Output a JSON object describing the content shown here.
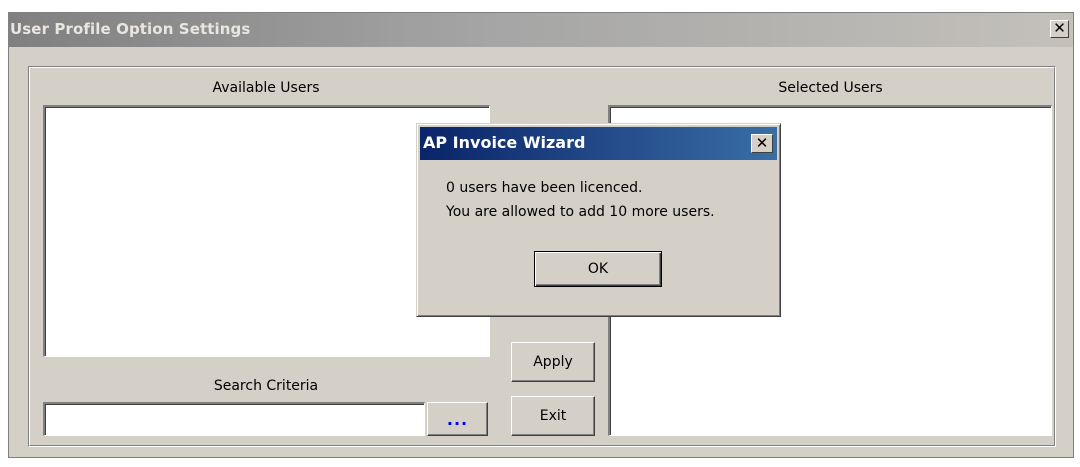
{
  "window": {
    "title": "User Profile Option Settings",
    "close_glyph": "✕"
  },
  "main": {
    "available_users_label": "Available Users",
    "selected_users_label": "Selected Users",
    "search_criteria_label": "Search Criteria",
    "search_value": "",
    "ellipsis_label": "...",
    "apply_label": "Apply",
    "exit_label": "Exit",
    "available_users": [],
    "selected_users": []
  },
  "dialog": {
    "title": "AP Invoice Wizard",
    "close_glyph": "✕",
    "message_line1": "0 users have been licenced.",
    "message_line2": "You are allowed to add 10 more users.",
    "ok_label": "OK"
  },
  "colors": {
    "face": "#d4d0c8",
    "active_title_start": "#0a246a",
    "active_title_end": "#3a6ea5",
    "inactive_title_start": "#808080",
    "inactive_title_end": "#c4c1bb",
    "ellipsis": "#0000ff"
  }
}
